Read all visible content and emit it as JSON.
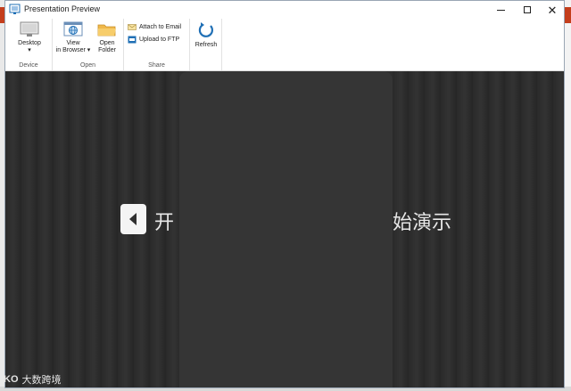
{
  "window": {
    "title": "Presentation Preview",
    "controls": {
      "minimize": "minimize",
      "maximize": "maximize",
      "close": "✕"
    }
  },
  "ribbon": {
    "groups": {
      "device": {
        "label": "Device",
        "desktop": {
          "line1": "Desktop",
          "line2": "▾"
        }
      },
      "open": {
        "label": "Open",
        "view_in_browser": {
          "line1": "View",
          "line2": "in Browser ▾"
        },
        "open_folder": {
          "line1": "Open",
          "line2": "Folder"
        }
      },
      "share": {
        "label": "Share",
        "attach_to_email": "Attach to Email",
        "upload_to_ftp": "Upload to FTP"
      },
      "refresh": {
        "label": "Refresh"
      }
    }
  },
  "preview": {
    "start_text_left": "开",
    "start_text_right": "始演示"
  },
  "watermark": {
    "logo": "KO",
    "text": "大数跨境"
  },
  "colors": {
    "preview_bg": "#2f2f2f",
    "text_light": "#e8e8e8",
    "accent_blue": "#1f6fb5"
  }
}
